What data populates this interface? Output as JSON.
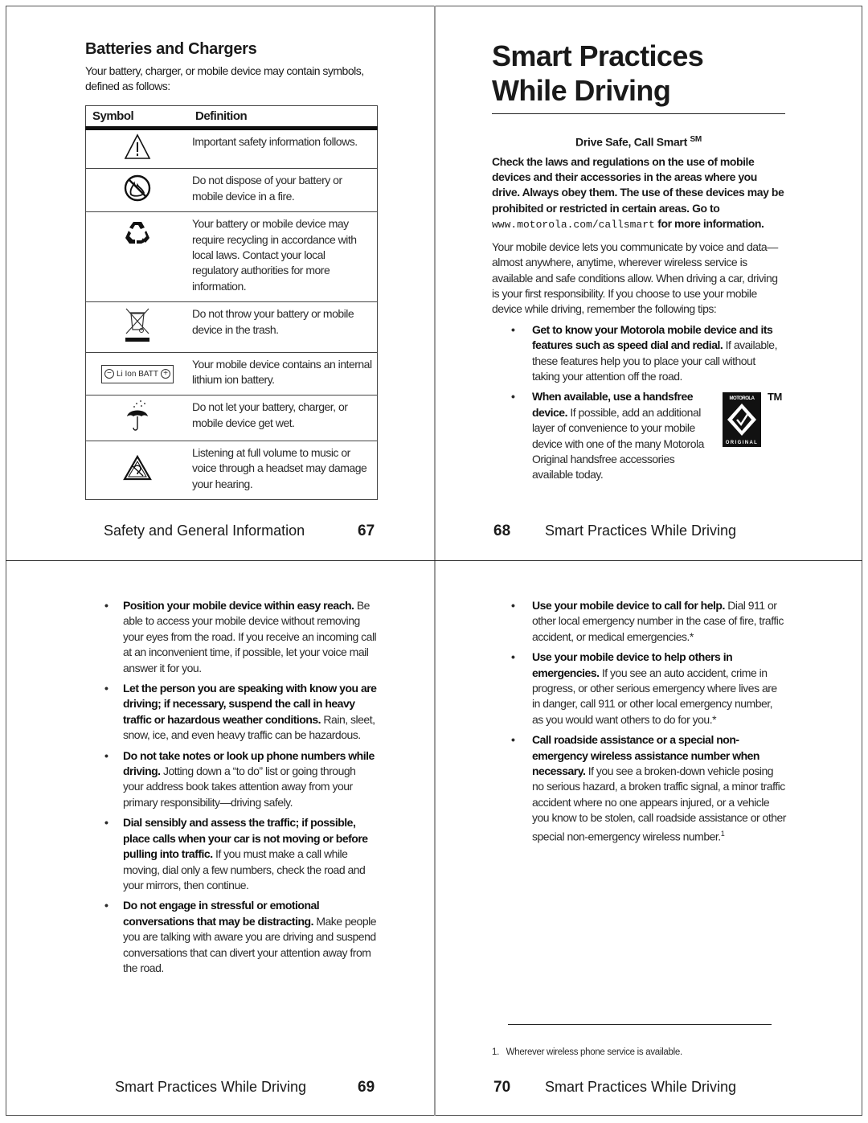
{
  "page67": {
    "heading": "Batteries and Chargers",
    "intro": "Your battery, charger, or mobile device may contain symbols, defined as follows:",
    "table": {
      "headers": [
        "Symbol",
        "Definition"
      ],
      "rows": [
        {
          "icon": "warning-triangle-icon",
          "definition": "Important safety information follows."
        },
        {
          "icon": "no-fire-icon",
          "definition": "Do not dispose of your battery or mobile device in a fire."
        },
        {
          "icon": "recycle-icon",
          "definition": "Your battery or mobile device may require recycling in accordance with local laws. Contact your local regulatory authorities for more information."
        },
        {
          "icon": "no-trash-bin-icon",
          "definition": "Do not throw your battery or mobile device in the trash."
        },
        {
          "icon": "li-ion-battery-icon",
          "icon_label": "Li Ion BATT",
          "definition": "Your mobile device contains an internal lithium ion battery."
        },
        {
          "icon": "umbrella-rain-icon",
          "definition": "Do not let your battery, charger, or mobile device get wet."
        },
        {
          "icon": "hearing-damage-icon",
          "definition": "Listening at full volume to music or voice through a headset may damage your hearing."
        }
      ]
    },
    "footer_title": "Safety and General Information",
    "page_number": "67"
  },
  "page68": {
    "title": "Smart Practices While Driving",
    "subtitle": "Drive Safe, Call Smart",
    "subtitle_mark": "SM",
    "warning_before_url": "Check the laws and regulations on the use of mobile devices and their accessories in the areas where you drive. Always obey them. The use of these devices may be prohibited or restricted in certain areas. Go to",
    "url": "www.motorola.com/callsmart",
    "warning_after_url": "for more information.",
    "paragraph": "Your mobile device lets you communicate by voice and data—almost anywhere, anytime, wherever wireless service is available and safe conditions allow. When driving a car, driving is your first responsibility. If you choose to use your mobile device while driving, remember the following tips:",
    "tips": [
      {
        "bold": "Get to know your Motorola mobile device and its features such as speed dial and redial.",
        "text": " If available, these features help you to place your call without taking your attention off the road."
      },
      {
        "bold": "When available, use a handsfree device.",
        "text": " If possible, add an additional layer of convenience to your mobile device with one of the many Motorola Original handsfree accessories available today."
      }
    ],
    "logo": {
      "top_text": "MOTOROLA",
      "bottom_text": "ORIGINAL",
      "tm": "TM"
    },
    "footer_title": "Smart Practices While Driving",
    "page_number": "68"
  },
  "page69": {
    "tips": [
      {
        "bold": "Position your mobile device within easy reach.",
        "text": " Be able to access your mobile device without removing your eyes from the road. If you receive an incoming call at an inconvenient time, if possible, let your voice mail answer it for you."
      },
      {
        "bold": "Let the person you are speaking with know you are driving; if necessary, suspend the call in heavy traffic or hazardous weather conditions.",
        "text": " Rain, sleet, snow, ice, and even heavy traffic can be hazardous."
      },
      {
        "bold": "Do not take notes or look up phone numbers while driving.",
        "text": " Jotting down a “to do” list or going through your address book takes attention away from your primary responsibility—driving safely."
      },
      {
        "bold": "Dial sensibly and assess the traffic; if possible, place calls when your car is not moving or before pulling into traffic.",
        "text": " If you must make a call while moving, dial only a few numbers, check the road and your mirrors, then continue."
      },
      {
        "bold": "Do not engage in stressful or emotional conversations that may be distracting.",
        "text": " Make people you are talking with aware you are driving and suspend conversations that can divert your attention away from the road."
      }
    ],
    "footer_title": "Smart Practices While Driving",
    "page_number": "69"
  },
  "page70": {
    "tips": [
      {
        "bold": "Use your mobile device to call for help.",
        "text": " Dial 911 or other local emergency number in the case of fire, traffic accident, or medical emergencies.*"
      },
      {
        "bold": "Use your mobile device to help others in emergencies.",
        "text": " If you see an auto accident, crime in progress, or other serious emergency where lives are in danger, call 911 or other local emergency number, as you would want others to do for you.*"
      },
      {
        "bold": "Call roadside assistance or a special non-emergency wireless assistance number when necessary.",
        "text": " If you see a broken-down vehicle posing no serious hazard, a broken traffic signal, a minor traffic accident where no one appears injured, or a vehicle you know to be stolen, call roadside assistance or other special non-emergency wireless number.",
        "footnote_ref": "1"
      }
    ],
    "footnote": "1.   Wherever wireless phone service is available.",
    "footer_title": "Smart Practices While Driving",
    "page_number": "70"
  },
  "bullet": "•"
}
